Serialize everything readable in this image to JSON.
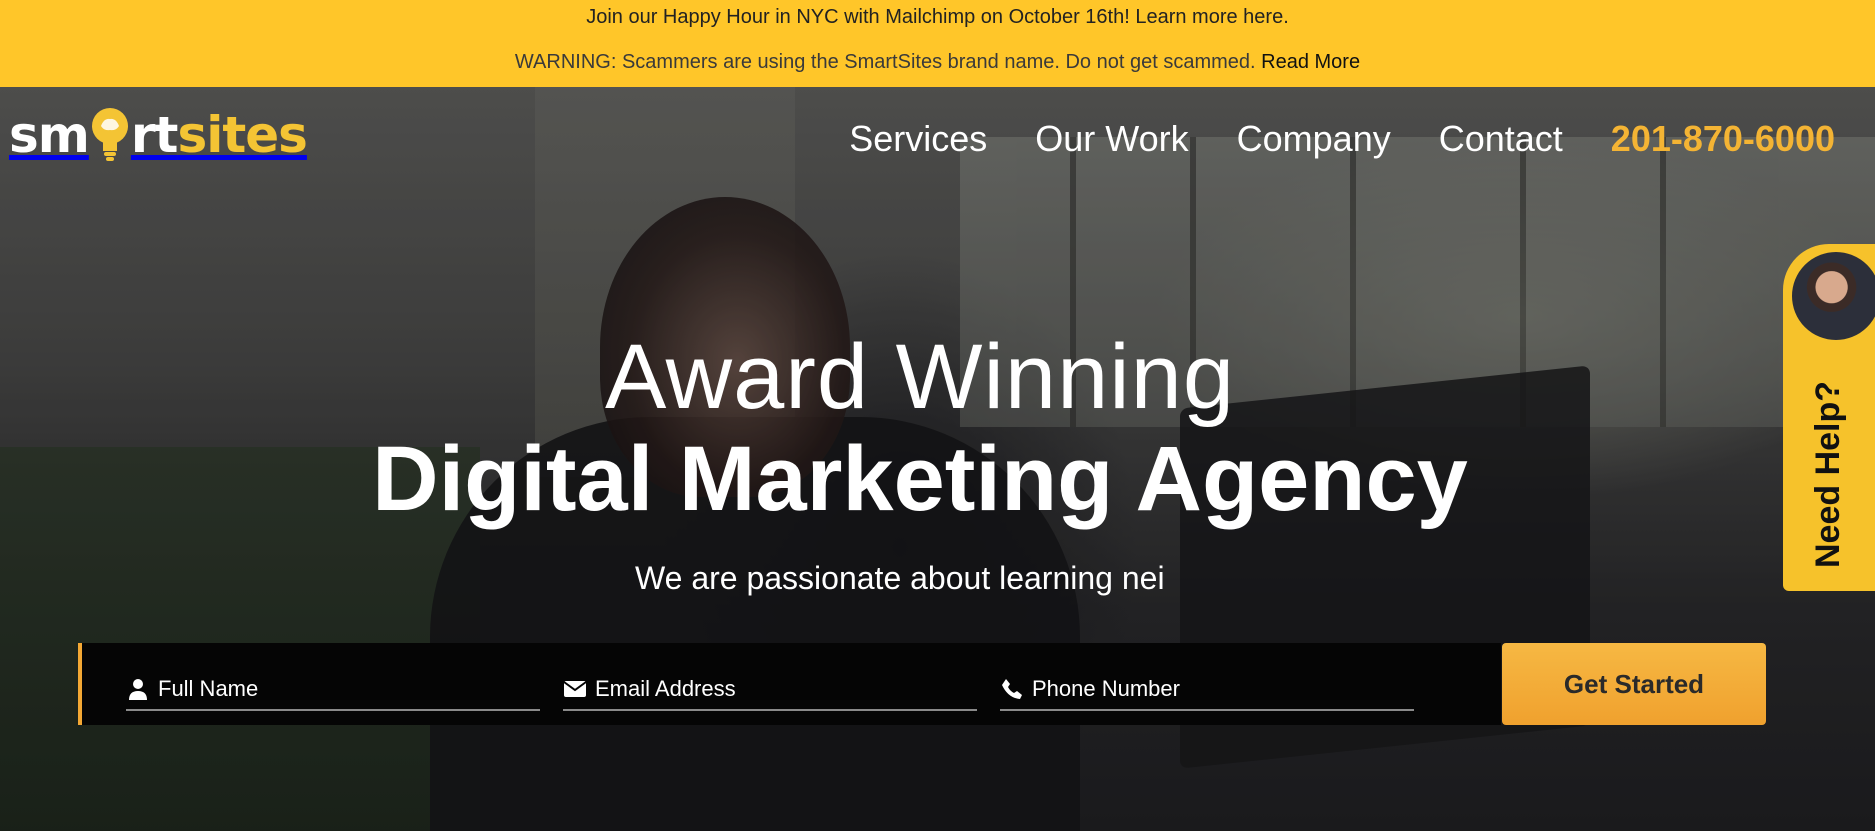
{
  "announcement": {
    "line1": "Join our Happy Hour in NYC with Mailchimp on October 16th! Learn more here.",
    "line2_text": "WARNING: Scammers are using the SmartSites brand name. Do not get scammed.",
    "line2_link": "Read More"
  },
  "brand": {
    "logo_part1": "sm",
    "logo_part2": "rt",
    "logo_part3": "sites"
  },
  "nav": {
    "items": [
      {
        "label": "Services"
      },
      {
        "label": "Our Work"
      },
      {
        "label": "Company"
      },
      {
        "label": "Contact"
      }
    ],
    "phone": "201-870-6000"
  },
  "hero": {
    "title_line1": "Award Winning",
    "title_line2": "Digital Marketing Agency",
    "tagline": "We are passionate about learning nei"
  },
  "form": {
    "name_placeholder": "Full Name",
    "email_placeholder": "Email Address",
    "phone_placeholder": "Phone Number",
    "submit_label": "Get Started"
  },
  "help_widget": {
    "label": "Need Help?"
  },
  "colors": {
    "announcement_bg": "#ffc629",
    "accent": "#f4b434",
    "button": "#f0a12e"
  }
}
